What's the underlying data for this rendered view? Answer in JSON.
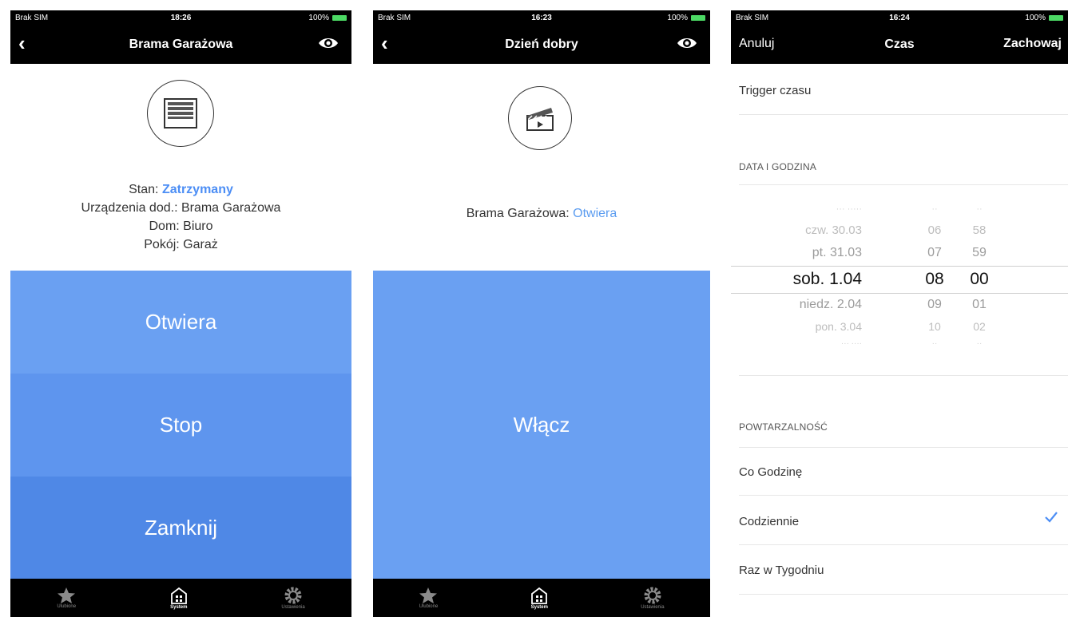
{
  "screen1": {
    "status": {
      "carrier": "Brak SIM",
      "time": "18:26",
      "battery": "100%"
    },
    "title": "Brama Garażowa",
    "back_icon": "chevron-left-icon",
    "eye_icon": "eye-icon",
    "device_icon": "garage-door-icon",
    "state_label": "Stan:",
    "state_value": "Zatrzymany",
    "state_color": "#4c8ef5",
    "device_line": "Urządzenia dod.: Brama Garażowa",
    "home_line": "Dom: Biuro",
    "room_line": "Pokój: Garaż",
    "buttons": [
      "Otwiera",
      "Stop",
      "Zamknij"
    ],
    "button_colors": [
      "#6aa0f2",
      "#5e95ee",
      "#4f88e6"
    ]
  },
  "screen2": {
    "status": {
      "carrier": "Brak SIM",
      "time": "16:23",
      "battery": "100%"
    },
    "title": "Dzień dobry",
    "back_icon": "chevron-left-icon",
    "eye_icon": "eye-icon",
    "device_icon": "clapperboard-icon",
    "device_label": "Brama Garażowa:",
    "device_value": "Otwiera",
    "button": "Włącz",
    "button_color": "#6aa0f2"
  },
  "screen3": {
    "status": {
      "carrier": "Brak SIM",
      "time": "16:24",
      "battery": "100%"
    },
    "cancel": "Anuluj",
    "title": "Czas",
    "save": "Zachowaj",
    "trigger": "Trigger czasu",
    "date_section": "DATA I GODZINA",
    "picker": [
      {
        "date": "czw. 30.03",
        "hour": "06",
        "minute": "58",
        "level": "dim"
      },
      {
        "date": "pt. 31.03",
        "hour": "07",
        "minute": "59",
        "level": "near"
      },
      {
        "date": "sob. 1.04",
        "hour": "08",
        "minute": "00",
        "level": "selected"
      },
      {
        "date": "niedz. 2.04",
        "hour": "09",
        "minute": "01",
        "level": "near"
      },
      {
        "date": "pon. 3.04",
        "hour": "10",
        "minute": "02",
        "level": "dim"
      }
    ],
    "repeat_section": "POWTARZALNOŚĆ",
    "repeat_options": [
      "Co Godzinę",
      "Codziennie",
      "Raz w Tygodniu"
    ],
    "selected_repeat": "Codziennie",
    "check_icon": "checkmark-icon"
  },
  "tabbar": {
    "tabs": [
      {
        "label": "Ulubione",
        "icon": "star-icon"
      },
      {
        "label": "System",
        "icon": "house-icon"
      },
      {
        "label": "Ustawienia",
        "icon": "gear-icon"
      }
    ],
    "active": "System"
  }
}
